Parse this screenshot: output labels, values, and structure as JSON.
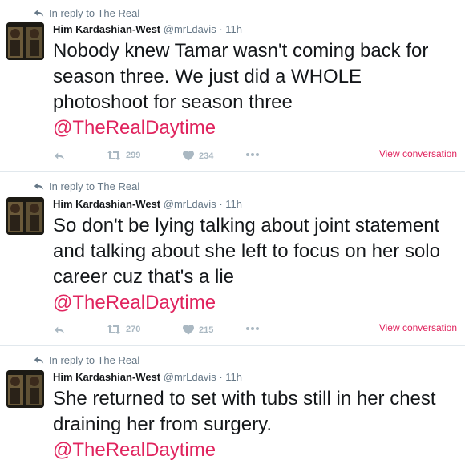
{
  "colors": {
    "accent": "#e0245e",
    "muted": "#657786",
    "icon": "#aab8c2",
    "text": "#14171a"
  },
  "tweets": [
    {
      "reply_to": "In reply to The Real",
      "name": "Him Kardashian-West",
      "handle": "@mrLdavis",
      "time": "· 11h",
      "text": "Nobody knew Tamar wasn't coming back for season three. We just did a WHOLE photoshoot for season three",
      "mention": "@TheRealDaytime",
      "retweets": "299",
      "likes": "234",
      "view_conversation": "View conversation"
    },
    {
      "reply_to": "In reply to The Real",
      "name": "Him Kardashian-West",
      "handle": "@mrLdavis",
      "time": "· 11h",
      "text": "So don't be lying talking about joint statement and talking about she left to focus on her solo career cuz that's a lie",
      "mention": "@TheRealDaytime",
      "retweets": "270",
      "likes": "215",
      "view_conversation": "View conversation"
    },
    {
      "reply_to": "In reply to The Real",
      "name": "Him Kardashian-West",
      "handle": "@mrLdavis",
      "time": "· 11h",
      "text": "She returned to set with tubs still in her chest draining her from surgery.",
      "mention": "@TheRealDaytime"
    }
  ]
}
